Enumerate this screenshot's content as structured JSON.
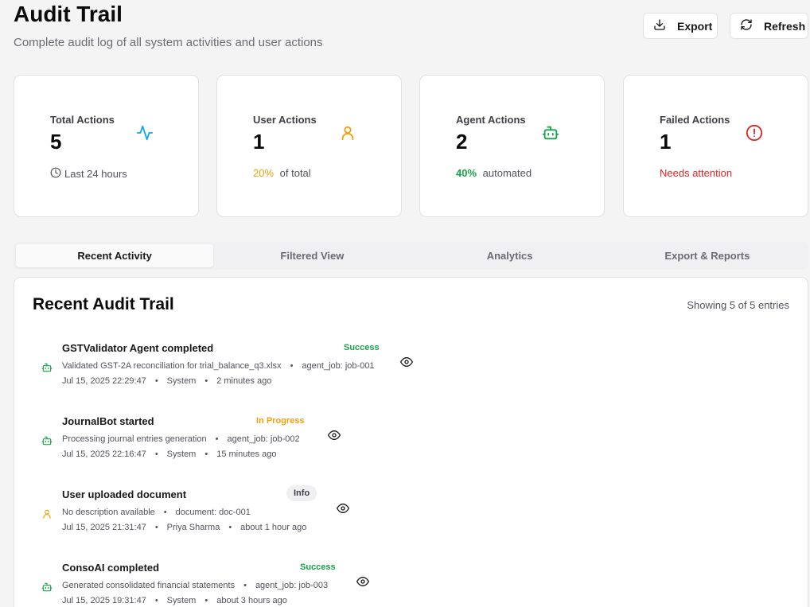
{
  "header": {
    "title": "Audit Trail",
    "subtitle": "Complete audit log of all system activities and user actions",
    "export_label": "Export",
    "refresh_label": "Refresh"
  },
  "stats": [
    {
      "label": "Total Actions",
      "value": "5",
      "icon": "activity-icon",
      "foot_text": "Last 24 hours",
      "foot_icon": "clock-icon",
      "color": "#0ea5e9"
    },
    {
      "label": "User Actions",
      "value": "1",
      "icon": "user-icon",
      "foot_highlight": "20%",
      "foot_text": " of total",
      "color": "#f59e0b"
    },
    {
      "label": "Agent Actions",
      "value": "2",
      "icon": "bot-icon",
      "foot_highlight": "40%",
      "foot_text": " automated",
      "color": "#16a34a"
    },
    {
      "label": "Failed Actions",
      "value": "1",
      "icon": "alert-circle-icon",
      "foot_text": "Needs attention",
      "color": "#dc2626"
    }
  ],
  "tabs": [
    {
      "label": "Recent Activity",
      "active": true
    },
    {
      "label": "Filtered View",
      "active": false
    },
    {
      "label": "Analytics",
      "active": false
    },
    {
      "label": "Export & Reports",
      "active": false
    }
  ],
  "panel": {
    "title": "Recent Audit Trail",
    "count_text": "Showing 5 of 5 entries"
  },
  "entries": [
    {
      "title": "GSTValidator Agent completed",
      "status": "Success",
      "status_color": "#16a34a",
      "icon": "bot-icon",
      "description": "Validated GST-2A reconciliation for trial_balance_q3.xlsx",
      "reference": "agent_job: job-001",
      "timestamp": "Jul 15, 2025 22:29:47",
      "actor": "System",
      "relative_time": "2 minutes ago"
    },
    {
      "title": "JournalBot started",
      "status": "In Progress",
      "status_color": "#f59e0b",
      "icon": "bot-icon",
      "description": "Processing journal entries generation",
      "reference": "agent_job: job-002",
      "timestamp": "Jul 15, 2025 22:16:47",
      "actor": "System",
      "relative_time": "15 minutes ago"
    },
    {
      "title": "User uploaded document",
      "status": "Info",
      "status_color": "#3f3f46",
      "icon": "user-icon",
      "description": "No description available",
      "reference": "document: doc-001",
      "timestamp": "Jul 15, 2025 21:31:47",
      "actor": "Priya Sharma",
      "relative_time": "about 1 hour ago"
    },
    {
      "title": "ConsoAI completed",
      "status": "Success",
      "status_color": "#16a34a",
      "icon": "bot-icon",
      "description": "Generated consolidated financial statements",
      "reference": "agent_job: job-003",
      "timestamp": "Jul 15, 2025 19:31:47",
      "actor": "System",
      "relative_time": "about 3 hours ago"
    }
  ]
}
